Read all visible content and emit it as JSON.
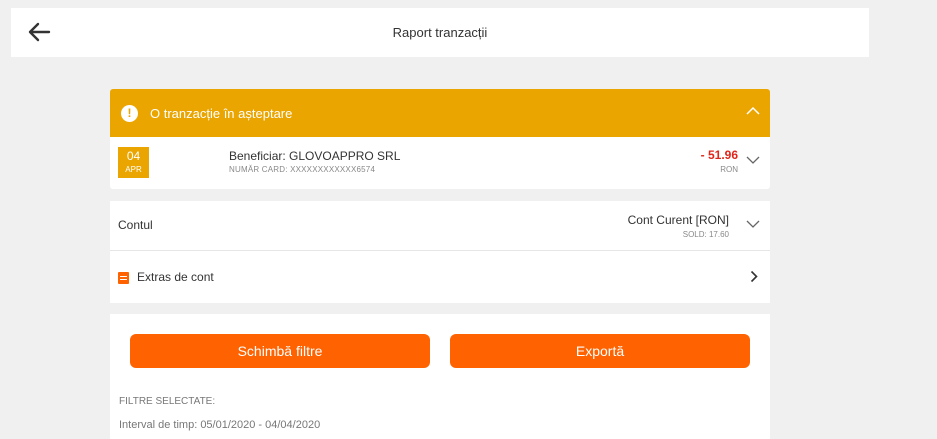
{
  "header": {
    "title": "Raport tranzacții",
    "back_icon": "arrow-left-icon"
  },
  "pending": {
    "title": "O tranzacție în așteptare",
    "info_icon": "info-icon",
    "collapse_icon": "chevron-up-icon",
    "accent_color": "#eaa500",
    "transaction": {
      "day": "04",
      "month": "APR",
      "beneficiary": "Beneficiar: GLOVOAPPRO SRL",
      "card_number": "NUMĂR CARD: XXXXXXXXXXXX6574",
      "amount": "- 51.96",
      "currency": "RON",
      "amount_color": "#e0251b"
    }
  },
  "account": {
    "label": "Contul",
    "name": "Cont Curent [RON]",
    "balance": "SOLD: 17.60"
  },
  "statement": {
    "label": "Extras de cont",
    "icon": "document-icon"
  },
  "filters": {
    "change_button": "Schimbă filtre",
    "export_button": "Exportă",
    "selected_label": "FILTRE SELECTATE:",
    "interval": "Interval de timp: 05/01/2020 - 04/04/2020",
    "button_color": "#ff6200"
  }
}
